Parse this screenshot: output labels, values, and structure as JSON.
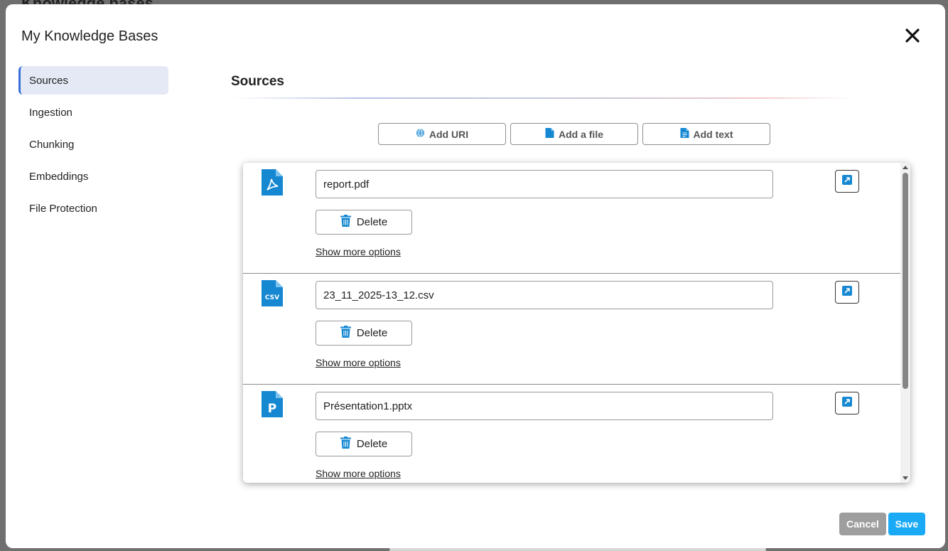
{
  "backdrop": {
    "title": "Knowledge bases"
  },
  "modal": {
    "title": "My Knowledge Bases",
    "close_icon": "close-icon"
  },
  "sidebar": {
    "items": [
      {
        "label": "Sources",
        "active": true
      },
      {
        "label": "Ingestion",
        "active": false
      },
      {
        "label": "Chunking",
        "active": false
      },
      {
        "label": "Embeddings",
        "active": false
      },
      {
        "label": "File Protection",
        "active": false
      }
    ]
  },
  "main": {
    "section_title": "Sources",
    "add_buttons": [
      {
        "label": "Add URI",
        "icon": "globe-icon"
      },
      {
        "label": "Add a file",
        "icon": "file-icon"
      },
      {
        "label": "Add text",
        "icon": "text-file-icon"
      }
    ],
    "sources": [
      {
        "name": "report.pdf",
        "icon": "pdf-file-icon",
        "delete_label": "Delete",
        "more_label": "Show more options"
      },
      {
        "name": "23_11_2025-13_12.csv",
        "icon": "csv-file-icon",
        "delete_label": "Delete",
        "more_label": "Show more options"
      },
      {
        "name": "Présentation1.pptx",
        "icon": "pptx-file-icon",
        "delete_label": "Delete",
        "more_label": "Show more options"
      }
    ]
  },
  "footer": {
    "cancel_label": "Cancel",
    "save_label": "Save"
  },
  "colors": {
    "accent": "#1aa9f5",
    "icon_blue": "#1688d2",
    "nav_active_bg": "#e4e9f5",
    "nav_active_border": "#3a6fd8",
    "cancel_bg": "#9e9e9e"
  }
}
